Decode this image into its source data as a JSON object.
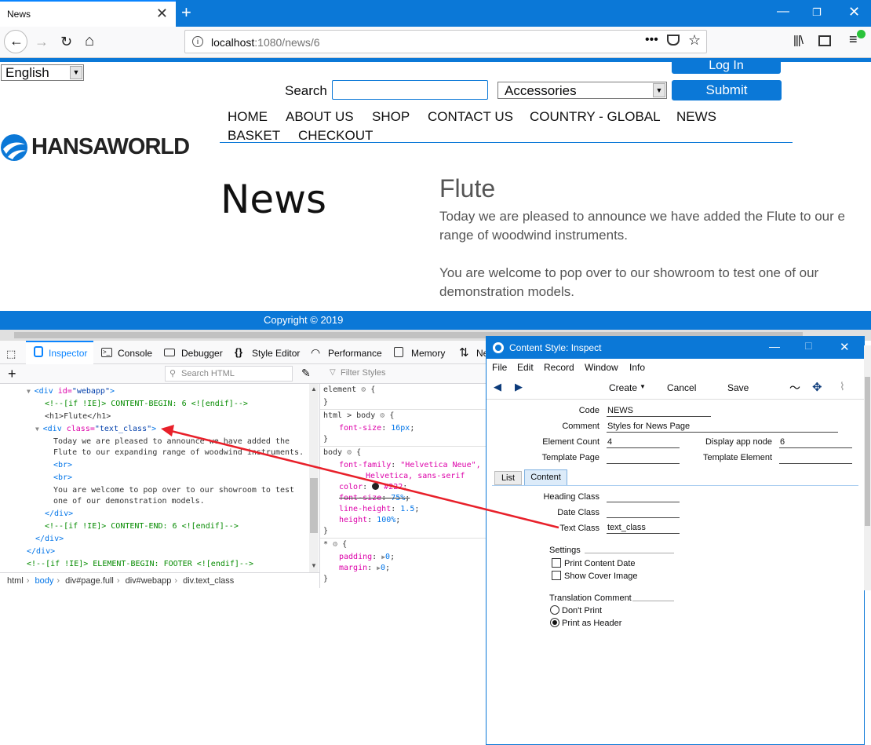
{
  "browser": {
    "tab_title": "News",
    "url_host": "localhost",
    "url_path": ":1080/news/6"
  },
  "page": {
    "language": "English",
    "login_label": "Log In",
    "search_label": "Search",
    "search_value": "",
    "category": "Accessories",
    "submit_label": "Submit",
    "menu": [
      "HOME",
      "ABOUT US",
      "SHOP",
      "CONTACT US",
      "COUNTRY - GLOBAL",
      "NEWS",
      "BASKET",
      "CHECKOUT"
    ],
    "logo_text": "HANSAWORLD",
    "news_heading": "News",
    "article_title": "Flute",
    "para1_line1": "Today we are pleased to announce we have added the Flute to our e",
    "para1_line2": "range of woodwind instruments.",
    "para2_line1": "You are welcome to pop over to our showroom to test one of our",
    "para2_line2": "demonstration models.",
    "footer": "Copyright © 2019"
  },
  "devtools": {
    "tabs": [
      "Inspector",
      "Console",
      "Debugger",
      "Style Editor",
      "Performance",
      "Memory",
      "Ne"
    ],
    "search_html_placeholder": "Search HTML",
    "filter_styles_placeholder": "Filter Styles",
    "html_lines": {
      "l1_tag": "<div ",
      "l1_attr": "id=",
      "l1_val": "\"webapp\"",
      "l1_end": ">",
      "l2": "<!--[if !IE]> CONTENT-BEGIN: 6 <![endif]-->",
      "l3": "<h1>Flute</h1>",
      "l4_tag": "<div ",
      "l4_attr": "class=",
      "l4_val": "\"text_class\"",
      "l4_end": ">",
      "l5": "Today we are pleased to announce we have added the",
      "l6": "Flute to our expanding range of woodwind instruments.",
      "l7": "<br>",
      "l8": "<br>",
      "l9": "You are welcome to pop over to our showroom to test",
      "l10": "one of our demonstration models.",
      "l11": "</div>",
      "l12": "<!--[if !IE]> CONTENT-END: 6 <![endif]-->",
      "l13": "</div>",
      "l14": "</div>",
      "l15": "<!--[if !IE]> ELEMENT-BEGIN: FOOTER <![endif]-->"
    },
    "breadcrumb": [
      "html",
      "body",
      "div#page.full",
      "div#webapp",
      "div.text_class"
    ],
    "rules": {
      "r1_sel": "element",
      "r2_sel": "html > body",
      "r2_p1": "font-size",
      "r2_v1": "16px",
      "r3_sel": "body",
      "r3_p1": "font-family",
      "r3_v1": "\"Helvetica Neue\", ",
      "r3_v1b": "Helvetica, sans-serif",
      "r3_p2": "color",
      "r3_v2": "#222",
      "r3_p3": "font-size",
      "r3_v3": "75%",
      "r3_p4": "line-height",
      "r3_v4": "1.5",
      "r3_p5": "height",
      "r3_v5": "100%",
      "r4_sel": "*",
      "r4_p1": "padding",
      "r4_v1": "0",
      "r4_p2": "margin",
      "r4_v2": "0"
    }
  },
  "inspect_window": {
    "title": "Content Style: Inspect",
    "menu": [
      "File",
      "Edit",
      "Record",
      "Window",
      "Info"
    ],
    "toolbar": {
      "create": "Create",
      "cancel": "Cancel",
      "save": "Save"
    },
    "fields": {
      "code_label": "Code",
      "code_value": "NEWS",
      "comment_label": "Comment",
      "comment_value": "Styles for News Page",
      "element_count_label": "Element Count",
      "element_count_value": "4",
      "display_app_node_label": "Display app node",
      "display_app_node_value": "6",
      "template_page_label": "Template Page",
      "template_page_value": "",
      "template_element_label": "Template Element",
      "template_element_value": ""
    },
    "tabs": [
      "List",
      "Content"
    ],
    "content": {
      "heading_class_label": "Heading Class",
      "heading_class_value": "",
      "date_class_label": "Date Class",
      "date_class_value": "",
      "text_class_label": "Text Class",
      "text_class_value": "text_class",
      "settings_label": "Settings",
      "print_content_date": "Print Content Date",
      "show_cover_image": "Show Cover Image",
      "translation_comment_label": "Translation Comment",
      "dont_print": "Don't Print",
      "print_as_header": "Print as Header"
    }
  },
  "colors": {
    "brand_blue": "#0b78d7",
    "arrow": "#e8202a"
  }
}
